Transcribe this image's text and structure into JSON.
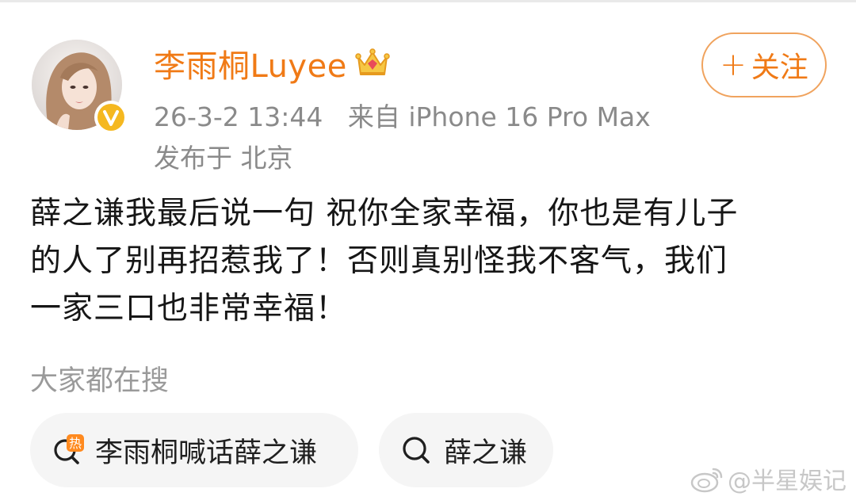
{
  "post": {
    "author": {
      "name": "李雨桐Luyee",
      "verified": true
    },
    "time": "26-3-2 13:44",
    "source": "来自 iPhone 16 Pro Max",
    "location": "发布于 北京",
    "follow_label": "关注",
    "content_lines": [
      "薛之谦我最后说一句 祝你全家幸福，你也是有儿子",
      "的人了别再招惹我了！否则真别怪我不客气，我们",
      "一家三口也非常幸福！"
    ]
  },
  "trending": {
    "title": "大家都在搜",
    "chips": [
      {
        "label": "李雨桐喊话薛之谦",
        "icon": "hot-search-icon",
        "hot_badge": "热"
      },
      {
        "label": "薛之谦",
        "icon": "search-icon"
      }
    ]
  },
  "watermark": {
    "text": "@半星娱记",
    "icon": "weibo-logo-icon"
  },
  "colors": {
    "accent": "#f07a16",
    "verified_badge": "#f5b820",
    "meta_text": "#8a8a8a",
    "chip_bg": "#f5f5f5"
  }
}
